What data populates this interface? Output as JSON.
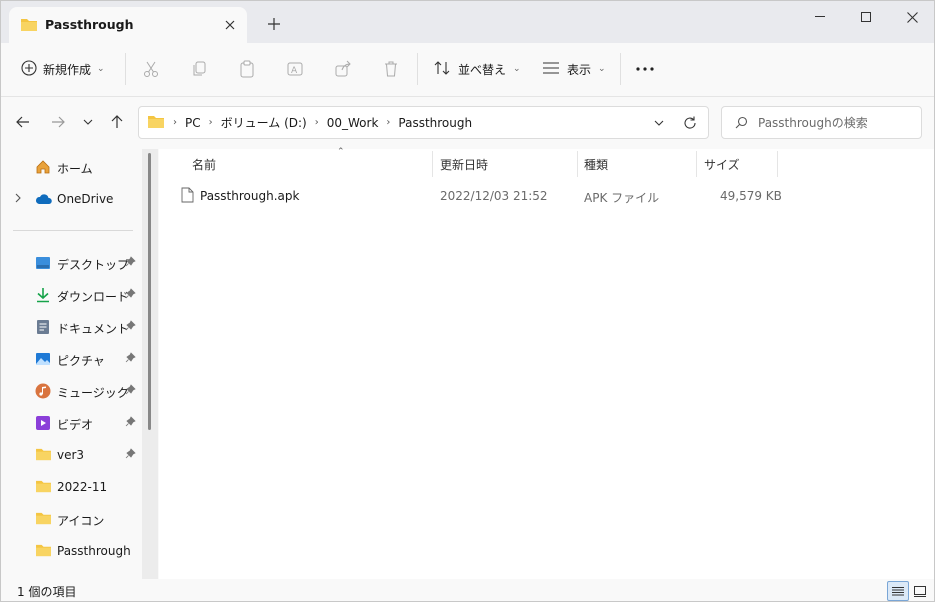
{
  "tab": {
    "title": "Passthrough"
  },
  "toolbar": {
    "new_label": "新規作成",
    "sort_label": "並べ替え",
    "view_label": "表示"
  },
  "address": {
    "crumbs": [
      "PC",
      "ボリューム (D:)",
      "00_Work",
      "Passthrough"
    ],
    "search_placeholder": "Passthroughの検索"
  },
  "nav": {
    "home": "ホーム",
    "onedrive": "OneDrive",
    "quick": [
      {
        "label": "デスクトップ",
        "icon": "desktop-icon"
      },
      {
        "label": "ダウンロード",
        "icon": "download-icon"
      },
      {
        "label": "ドキュメント",
        "icon": "document-icon"
      },
      {
        "label": "ピクチャ",
        "icon": "pictures-icon"
      },
      {
        "label": "ミュージック",
        "icon": "music-icon"
      },
      {
        "label": "ビデオ",
        "icon": "video-icon"
      },
      {
        "label": "ver3",
        "icon": "folder-icon"
      },
      {
        "label": "2022-11",
        "icon": "folder-icon"
      },
      {
        "label": "アイコン",
        "icon": "folder-icon"
      },
      {
        "label": "Passthrough",
        "icon": "folder-icon"
      }
    ]
  },
  "columns": {
    "name": "名前",
    "date": "更新日時",
    "type": "種類",
    "size": "サイズ"
  },
  "files": [
    {
      "name": "Passthrough.apk",
      "date": "2022/12/03 21:52",
      "type": "APK ファイル",
      "size": "49,579 KB"
    }
  ],
  "status": {
    "count": "1 個の項目"
  },
  "colors": {
    "folder": "#f4c542",
    "accent": "#0067c0"
  }
}
